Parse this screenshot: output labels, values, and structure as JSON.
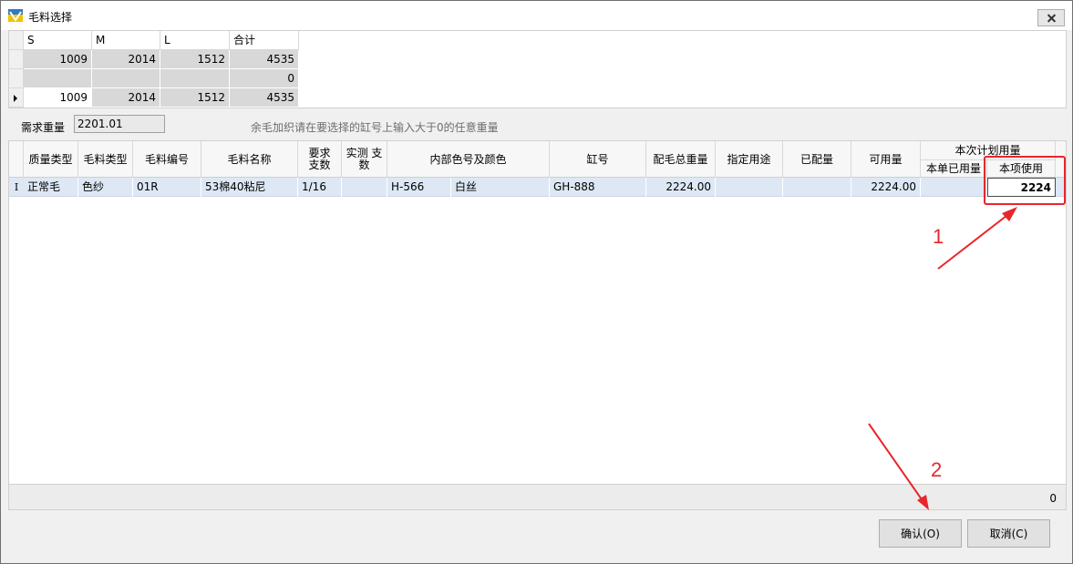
{
  "window": {
    "title": "毛料选择"
  },
  "size_grid": {
    "headers": [
      "S",
      "M",
      "L",
      "合计"
    ],
    "rows": [
      [
        "1009",
        "2014",
        "1512",
        "4535"
      ],
      [
        "",
        "",
        "",
        "0"
      ],
      [
        "1009",
        "2014",
        "1512",
        "4535"
      ]
    ]
  },
  "demand": {
    "label": "需求重量",
    "value": "2201.01",
    "hint": "余毛加织请在要选择的缸号上输入大于0的任意重量"
  },
  "grid": {
    "headers": {
      "quality_type": "质量类型",
      "yarn_type": "毛料类型",
      "yarn_code": "毛料编号",
      "yarn_name": "毛料名称",
      "req_count": "要求 支数",
      "actual_count": "实测 支数",
      "color": "内部色号及颜色",
      "lot": "缸号",
      "total_weight": "配毛总重量",
      "purpose": "指定用途",
      "allocated": "已配量",
      "available": "可用量",
      "plan_group": "本次计划用量",
      "used_this_order": "本单已用量",
      "use_this_item": "本项使用"
    },
    "row": {
      "indicator": "I",
      "quality_type": "正常毛",
      "yarn_type": "色纱",
      "yarn_code": "01R",
      "yarn_name": "53棉40粘尼",
      "req_count": "1/16",
      "actual_count": "",
      "color_code": "H-566",
      "color_name": "白丝",
      "lot": "GH-888",
      "total_weight": "2224.00",
      "purpose": "",
      "allocated": "",
      "available": "2224.00",
      "used_this_order": "",
      "use_this_item": "2224"
    }
  },
  "footer": {
    "sum": "0"
  },
  "buttons": {
    "confirm": "确认(O)",
    "cancel": "取消(C)"
  },
  "annotations": {
    "one": "1",
    "two": "2",
    "color": "#e8262b"
  }
}
